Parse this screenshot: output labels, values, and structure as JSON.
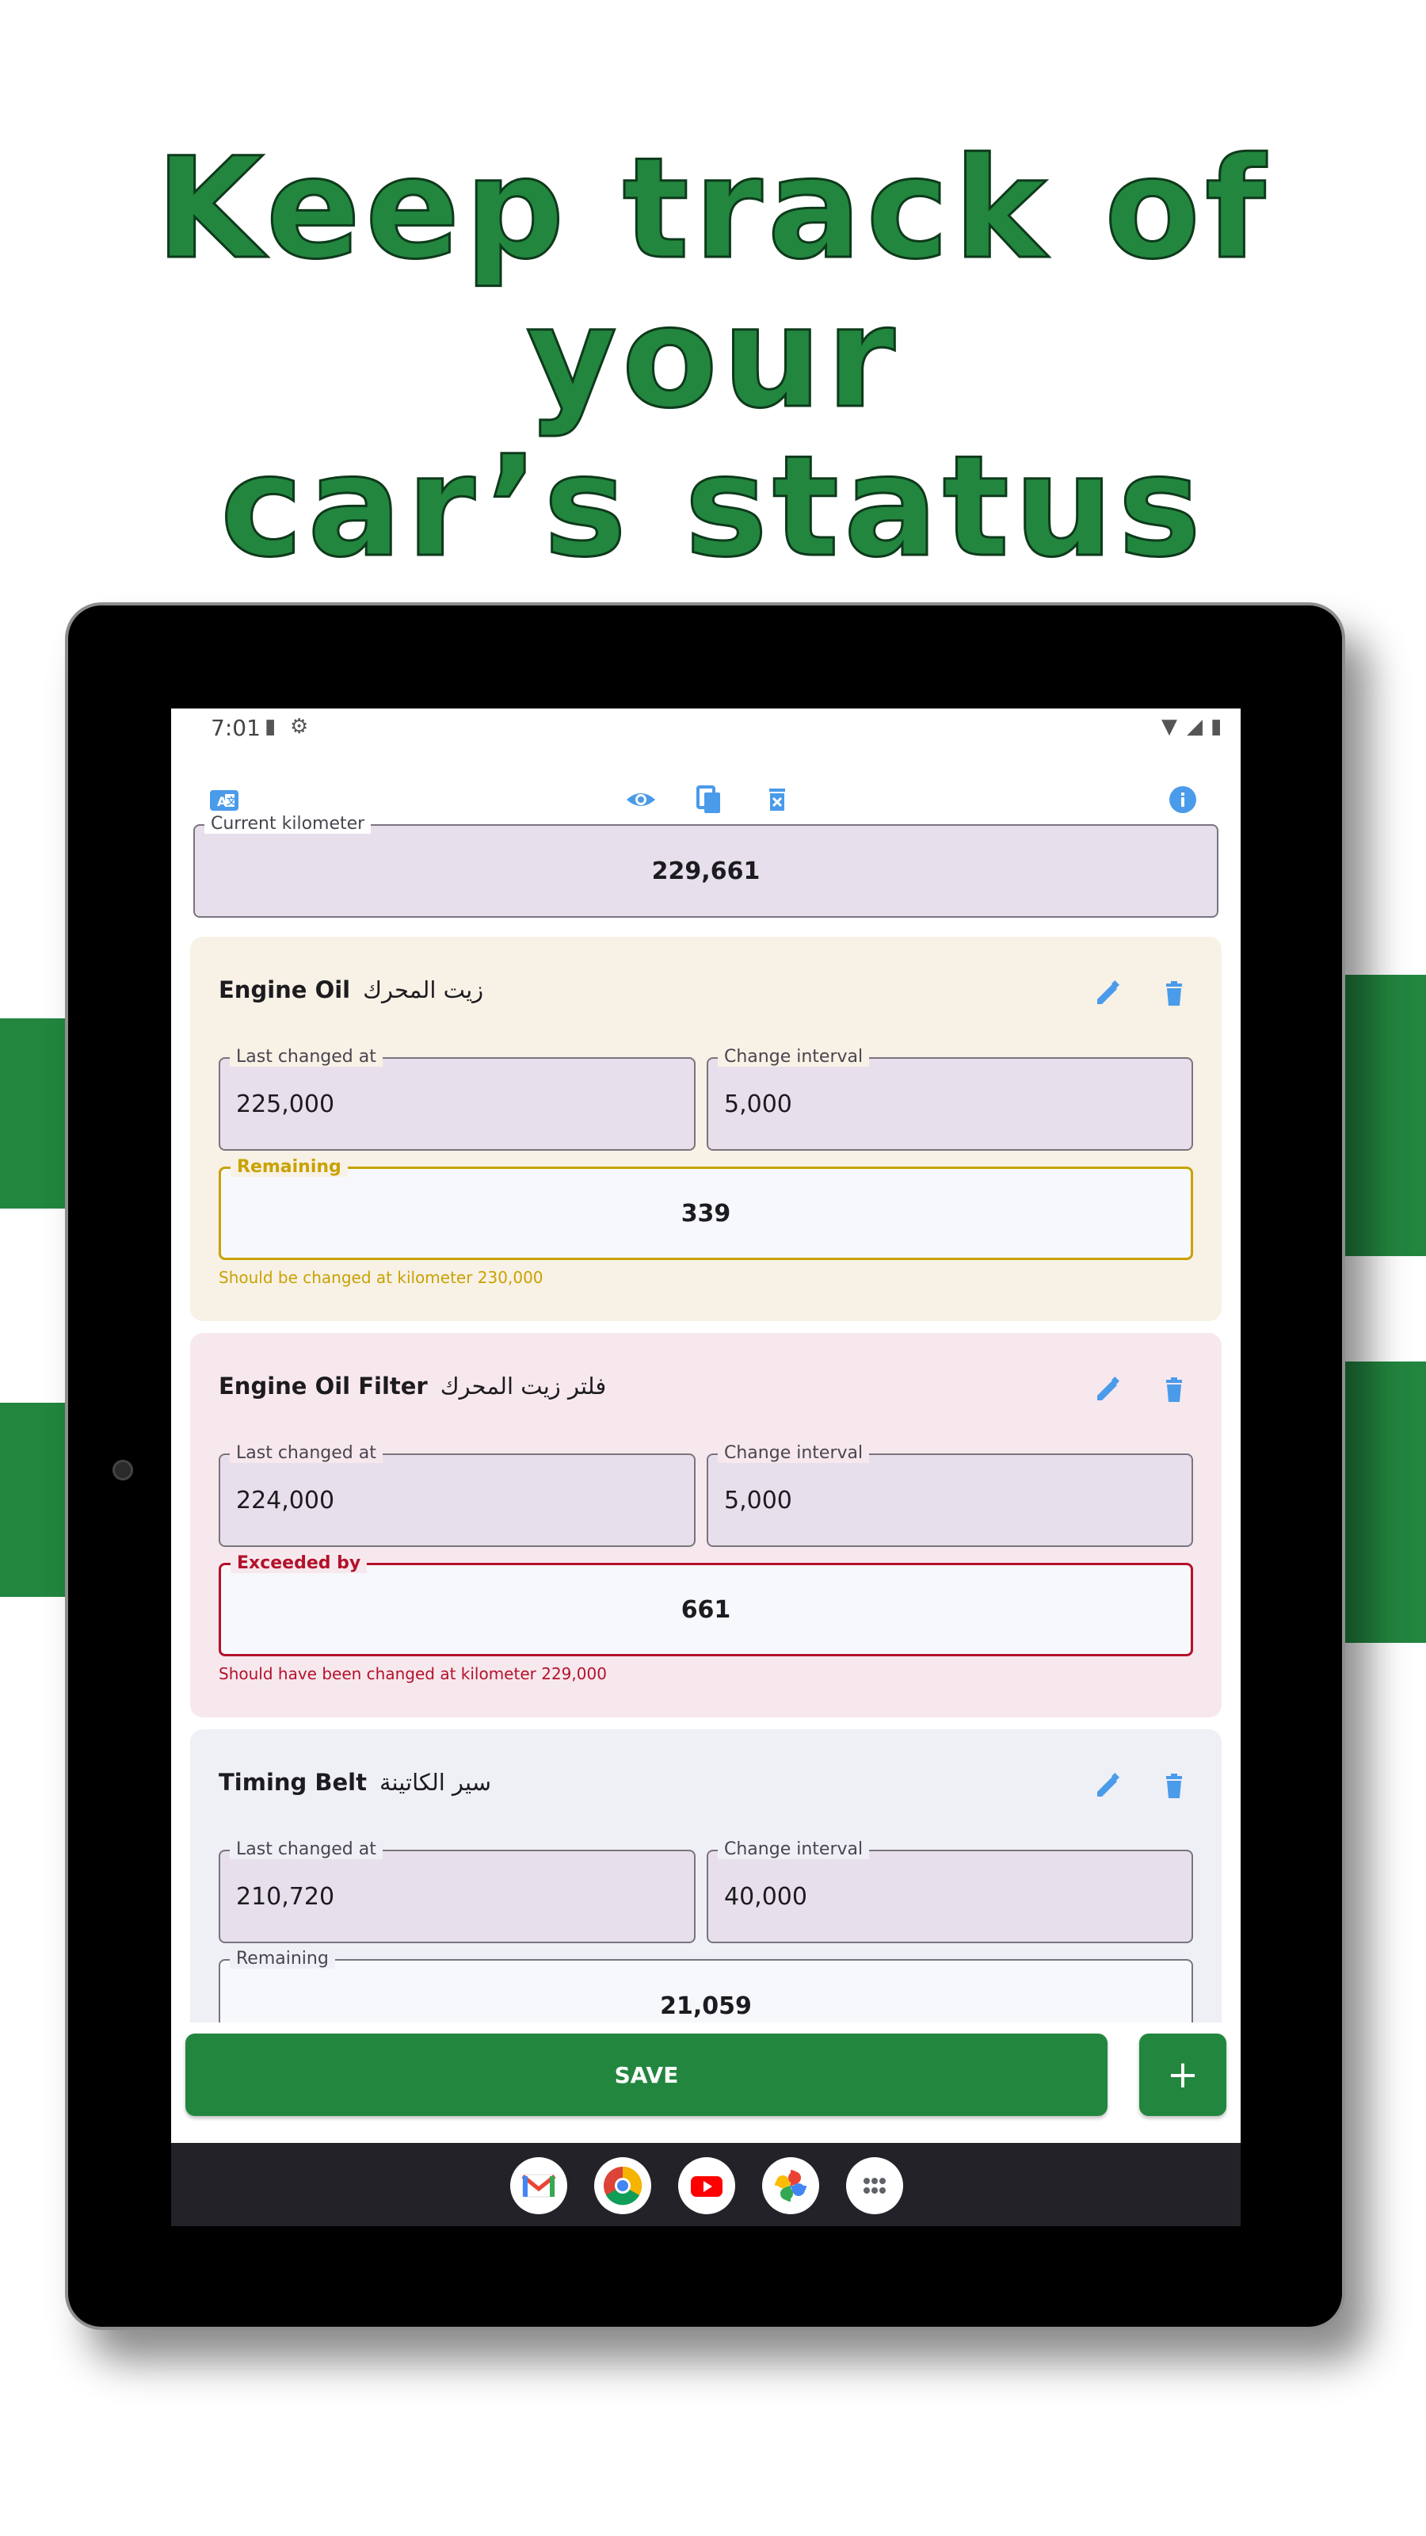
{
  "headline": {
    "line1": "Keep track of your",
    "line2": "car’s status"
  },
  "status_bar": {
    "time": "7:01"
  },
  "current_km": {
    "label": "Current kilometer",
    "value": "229,661"
  },
  "cards": [
    {
      "title": "Engine Oil",
      "title_ar": "زيت المحرك",
      "last_changed_label": "Last changed at",
      "last_changed_value": "225,000",
      "interval_label": "Change interval",
      "interval_value": "5,000",
      "status_label": "Remaining",
      "status_value": "339",
      "helper": "Should be changed at kilometer 230,000",
      "status": "warning",
      "background": "#f8f1e6",
      "accent": "#c9a200"
    },
    {
      "title": "Engine Oil Filter",
      "title_ar": "فلتر زيت المحرك",
      "last_changed_label": "Last changed at",
      "last_changed_value": "224,000",
      "interval_label": "Change interval",
      "interval_value": "5,000",
      "status_label": "Exceeded by",
      "status_value": "661",
      "helper": "Should have been changed at kilometer 229,000",
      "status": "exceeded",
      "background": "#f7e8ee",
      "accent": "#b3122a"
    },
    {
      "title": "Timing Belt",
      "title_ar": "سير الكاتينة",
      "last_changed_label": "Last changed at",
      "last_changed_value": "210,720",
      "interval_label": "Change interval",
      "interval_value": "40,000",
      "status_label": "Remaining",
      "status_value": "21,059",
      "status": "ok",
      "background": "#eff0f6",
      "accent": "#79747e"
    }
  ],
  "actions": {
    "save_label": "SAVE",
    "add_label": "+"
  },
  "colors": {
    "brand": "#22863f",
    "icon": "#4a9bea"
  }
}
